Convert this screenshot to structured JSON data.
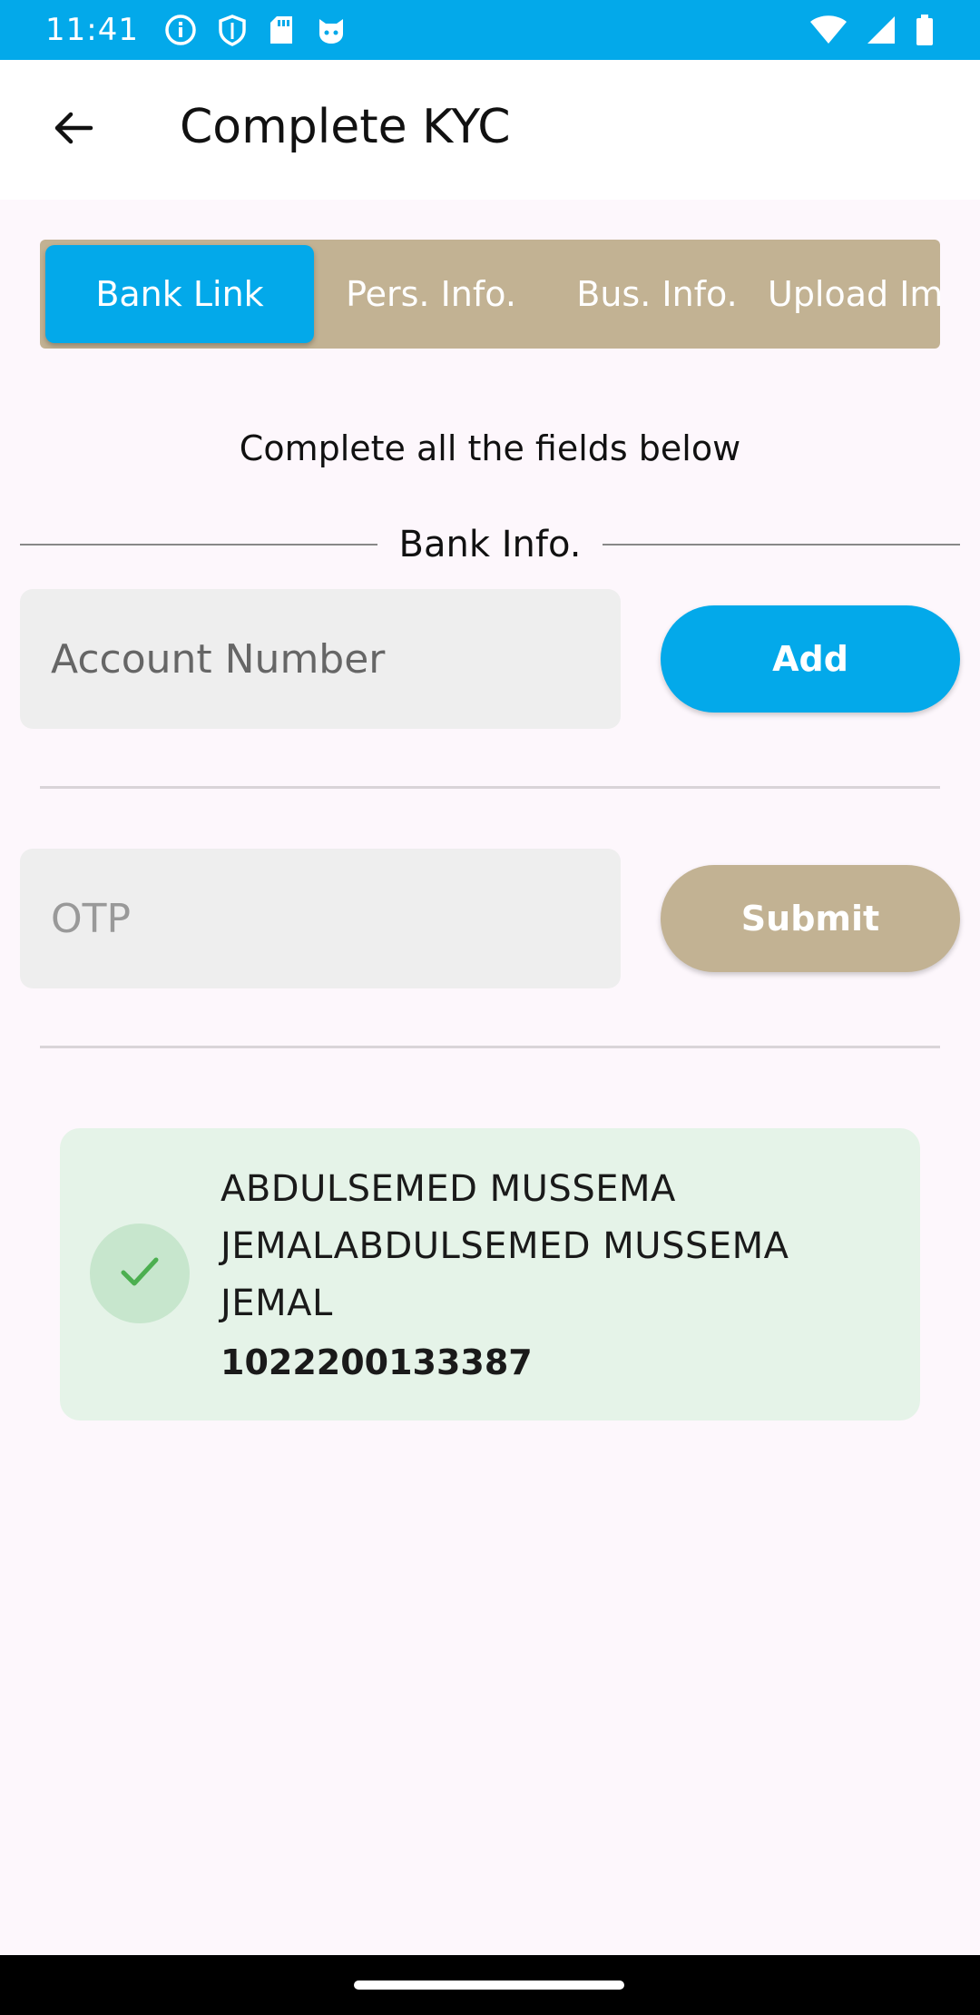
{
  "status_bar": {
    "time": "11:41",
    "left_icons": [
      "info-icon",
      "shield-icon",
      "sd-card-icon",
      "cat-face-icon"
    ],
    "right_icons": [
      "wifi-icon",
      "signal-icon",
      "battery-icon"
    ]
  },
  "app_bar": {
    "back_icon": "arrow-back-icon",
    "title": "Complete KYC"
  },
  "tabs": [
    {
      "label": "Bank Link",
      "active": true
    },
    {
      "label": "Pers. Info.",
      "active": false
    },
    {
      "label": "Bus. Info.",
      "active": false
    },
    {
      "label": "Upload Im",
      "active": false
    }
  ],
  "form": {
    "instruction": "Complete all the fields below",
    "section_label": "Bank Info.",
    "account_placeholder": "Account Number",
    "add_label": "Add",
    "otp_placeholder": "OTP",
    "submit_label": "Submit"
  },
  "account_card": {
    "name": "ABDULSEMED MUSSEMA JEMALABDULSEMED MUSSEMA JEMAL",
    "number": "1022200133387",
    "status_icon": "check-icon"
  },
  "colors": {
    "primary": "#03A9EA",
    "secondary": "#C2B293",
    "success_bg": "#E5F3E8",
    "success_icon": "#4CAF50"
  }
}
